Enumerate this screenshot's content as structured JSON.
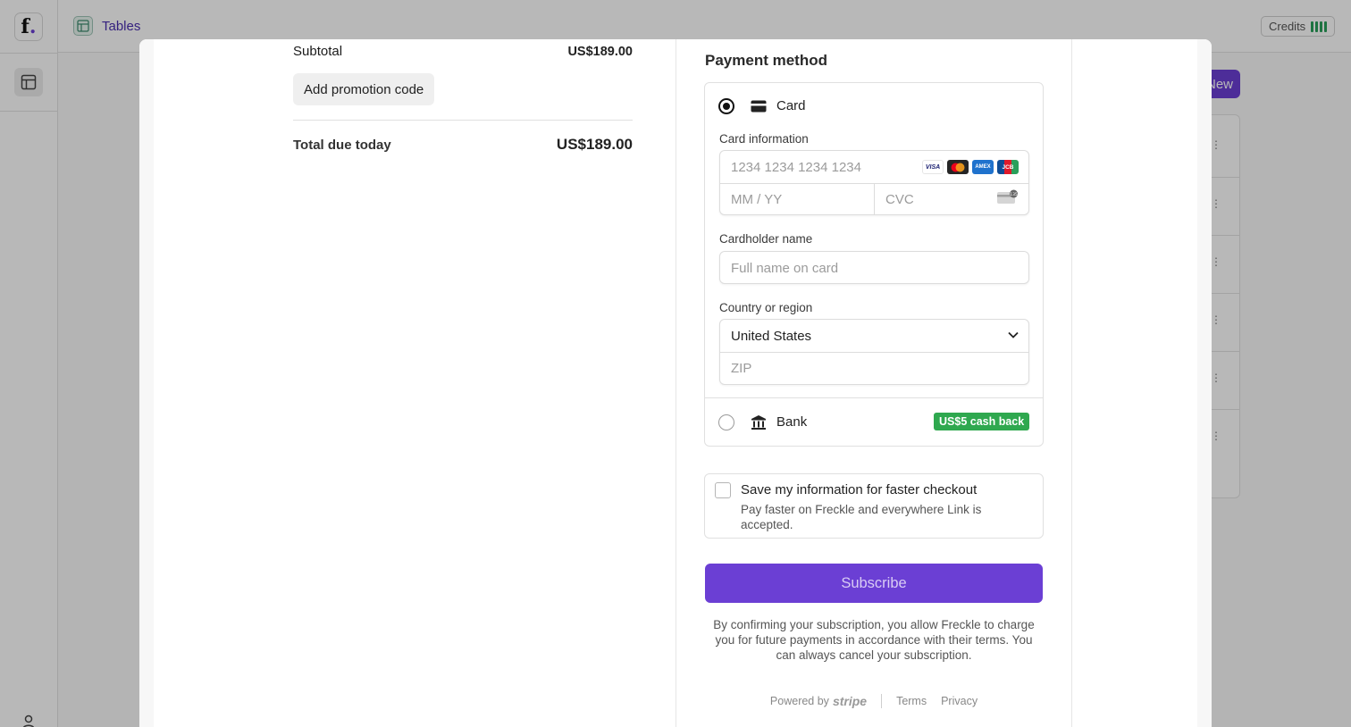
{
  "app": {
    "logo_letter": "f",
    "logo_dot": ".",
    "breadcrumb": "Tables",
    "credits_label": "Credits",
    "new_button": "New",
    "row_menu": "⋮"
  },
  "summary": {
    "subtotal_label": "Subtotal",
    "subtotal_amount": "US$189.00",
    "promo_button": "Add promotion code",
    "total_label": "Total due today",
    "total_amount": "US$189.00"
  },
  "payment": {
    "title": "Payment method",
    "card_option": "Card",
    "card_info_label": "Card information",
    "card_number_placeholder": "1234 1234 1234 1234",
    "expiry_placeholder": "MM / YY",
    "cvc_placeholder": "CVC",
    "brands": [
      "VISA",
      "MC",
      "AMEX",
      "JCB"
    ],
    "cardholder_label": "Cardholder name",
    "cardholder_placeholder": "Full name on card",
    "country_label": "Country or region",
    "country_value": "United States",
    "zip_placeholder": "ZIP",
    "bank_option": "Bank",
    "cashback_badge": "US$5 cash back",
    "selected": "card"
  },
  "save_info": {
    "title": "Save my information for faster checkout",
    "description": "Pay faster on Freckle and everywhere Link is accepted."
  },
  "subscribe_button": "Subscribe",
  "legal_text": "By confirming your subscription, you allow Freckle to charge you for future payments in accordance with their terms. You can always cancel your subscription.",
  "footer": {
    "powered_by": "Powered by",
    "stripe": "stripe",
    "terms": "Terms",
    "privacy": "Privacy"
  },
  "colors": {
    "accent": "#6b3fd4",
    "cashback": "#2fa84f",
    "credits_bar": "#2aa05a"
  }
}
